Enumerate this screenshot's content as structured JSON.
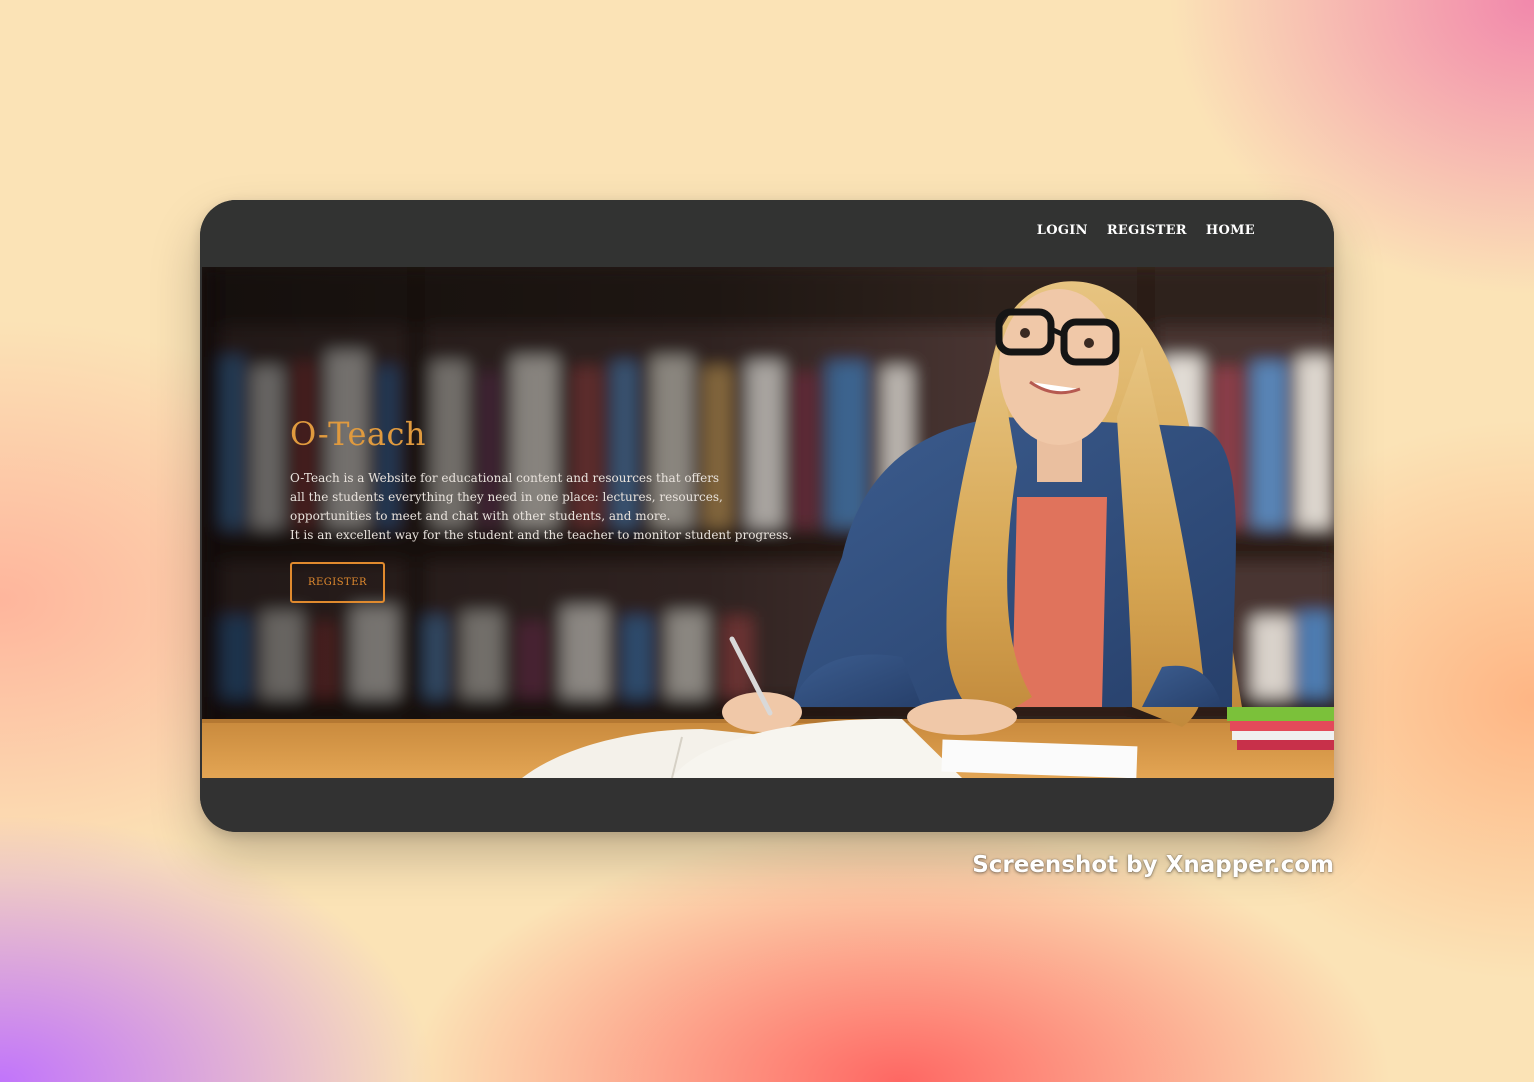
{
  "nav": {
    "links": [
      "LOGIN",
      "REGISTER",
      "HOME"
    ]
  },
  "hero": {
    "title": "O-Teach",
    "description_lines": [
      "O-Teach is a Website for educational content and resources that offers",
      "all the students everything they need in one place: lectures, resources,",
      "opportunities to meet and chat with other students, and more.",
      "It is an excellent way for the student and the teacher to monitor student progress."
    ],
    "register_button": "REGISTER"
  },
  "watermark": "Screenshot by Xnapper.com",
  "colors": {
    "nav_bg": "#323332",
    "accent": "#e08a2e",
    "title": "#e09a3e",
    "text": "#e8e2dc"
  },
  "icons": {
    "hero_image": "student-studying-photo"
  }
}
